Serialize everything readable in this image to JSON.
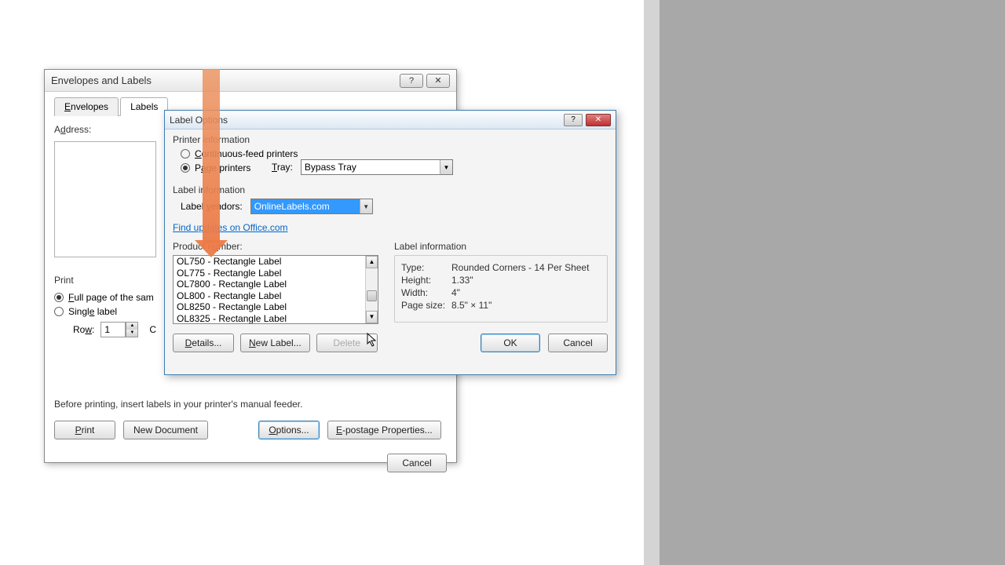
{
  "dialog1": {
    "title": "Envelopes and Labels",
    "tabs": {
      "envelopes": "Envelopes",
      "labels": "Labels"
    },
    "address_label": "Address:",
    "print": {
      "heading": "Print",
      "full_page": "Full page of the sam",
      "single": "Single label",
      "row_label": "Row:",
      "row_value": "1",
      "col_stub": "C"
    },
    "note": "Before printing, insert labels in your printer's manual feeder.",
    "buttons": {
      "print": "Print",
      "new_document": "New Document",
      "options": "Options...",
      "epostage": "E-postage Properties...",
      "cancel": "Cancel"
    }
  },
  "dialog2": {
    "title": "Label Options",
    "printer_info": "Printer information",
    "continuous": "Continuous-feed printers",
    "page_printers": "Page printers",
    "tray_label": "Tray:",
    "tray_value": "Bypass Tray",
    "label_info_heading": "Label information",
    "vendors_label": "Label vendors:",
    "vendor_value": "OnlineLabels.com",
    "updates_link": "Find updates on Office.com",
    "product_label": "Product number:",
    "products": [
      "OL750 - Rectangle Label",
      "OL775 - Rectangle Label",
      "OL7800 - Rectangle Label",
      "OL800 - Rectangle Label",
      "OL8250 - Rectangle Label",
      "OL8325 - Rectangle Label"
    ],
    "info_panel_heading": "Label information",
    "info": {
      "type_label": "Type:",
      "type_value": "Rounded Corners - 14 Per Sheet",
      "height_label": "Height:",
      "height_value": "1.33\"",
      "width_label": "Width:",
      "width_value": "4\"",
      "page_label": "Page size:",
      "page_value": "8.5\" × 11\""
    },
    "buttons": {
      "details": "Details...",
      "new_label": "New Label...",
      "delete": "Delete",
      "ok": "OK",
      "cancel": "Cancel"
    }
  }
}
